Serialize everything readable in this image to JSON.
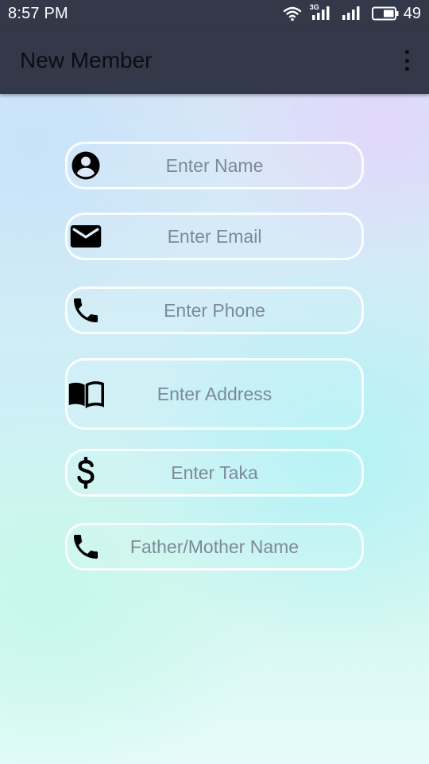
{
  "status_bar": {
    "time": "8:57 PM",
    "network_label": "3G",
    "battery_level": "49"
  },
  "app_bar": {
    "title": "New Member",
    "overflow_icon": "more-vert-icon"
  },
  "form": {
    "fields": [
      {
        "id": "name",
        "icon": "account-circle-icon",
        "placeholder": "Enter Name",
        "value": ""
      },
      {
        "id": "email",
        "icon": "email-icon",
        "placeholder": "Enter Email",
        "value": ""
      },
      {
        "id": "phone",
        "icon": "phone-icon",
        "placeholder": "Enter Phone",
        "value": ""
      },
      {
        "id": "address",
        "icon": "book-icon",
        "placeholder": "Enter Address",
        "value": ""
      },
      {
        "id": "taka",
        "icon": "dollar-icon",
        "placeholder": "Enter Taka",
        "value": ""
      },
      {
        "id": "parent",
        "icon": "phone-icon",
        "placeholder": "Father/Mother Name",
        "value": ""
      }
    ]
  },
  "colors": {
    "app_bar_background": "#333949",
    "field_border": "#ffffff",
    "placeholder_text": "#7c8a97"
  }
}
